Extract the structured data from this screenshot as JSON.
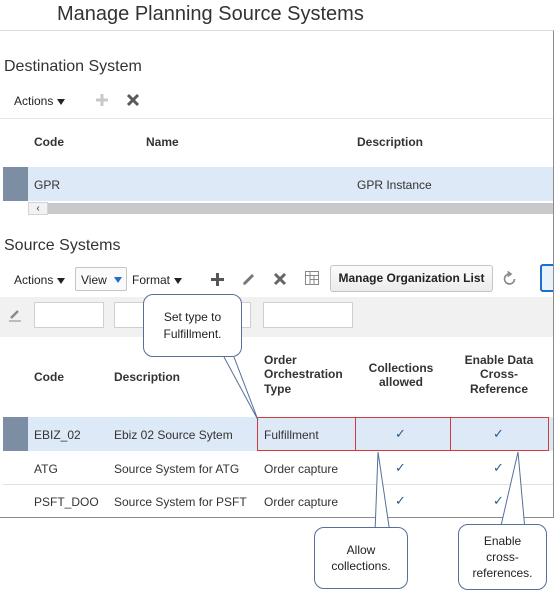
{
  "page": {
    "title": "Manage Planning Source Systems"
  },
  "destination": {
    "heading": "Destination System",
    "actions_label": "Actions",
    "columns": {
      "code": "Code",
      "name": "Name",
      "description": "Description"
    },
    "row": {
      "code": "GPR",
      "name": "",
      "description": "GPR Instance"
    }
  },
  "source": {
    "heading": "Source Systems",
    "actions_label": "Actions",
    "view_label": "View",
    "format_label": "Format",
    "manage_org_list_label": "Manage Organization List",
    "columns": {
      "code": "Code",
      "description": "Description",
      "order_type": "Order Orchestration Type",
      "collections": "Collections allowed",
      "cross_ref": "Enable Data Cross-Reference"
    },
    "rows": [
      {
        "code": "EBIZ_02",
        "description": "Ebiz 02 Source Sytem",
        "type": "Fulfillment",
        "collections": "✓",
        "cross_ref": "✓"
      },
      {
        "code": "ATG",
        "description": "Source System for ATG",
        "type": "Order capture",
        "collections": "✓",
        "cross_ref": "✓"
      },
      {
        "code": "PSFT_DOO",
        "description": "Source System for PSFT",
        "type": "Order capture",
        "collections": "✓",
        "cross_ref": "✓"
      }
    ]
  },
  "callouts": {
    "set_type": "Set type to Fulfillment.",
    "allow_collections": "Allow collections.",
    "enable_cross_ref": "Enable cross-references."
  },
  "colors": {
    "selected_row": "#dde9f6",
    "highlight_border": "#d33a3a",
    "callout_border": "#54709a",
    "link_blue": "#1a6fd0"
  }
}
